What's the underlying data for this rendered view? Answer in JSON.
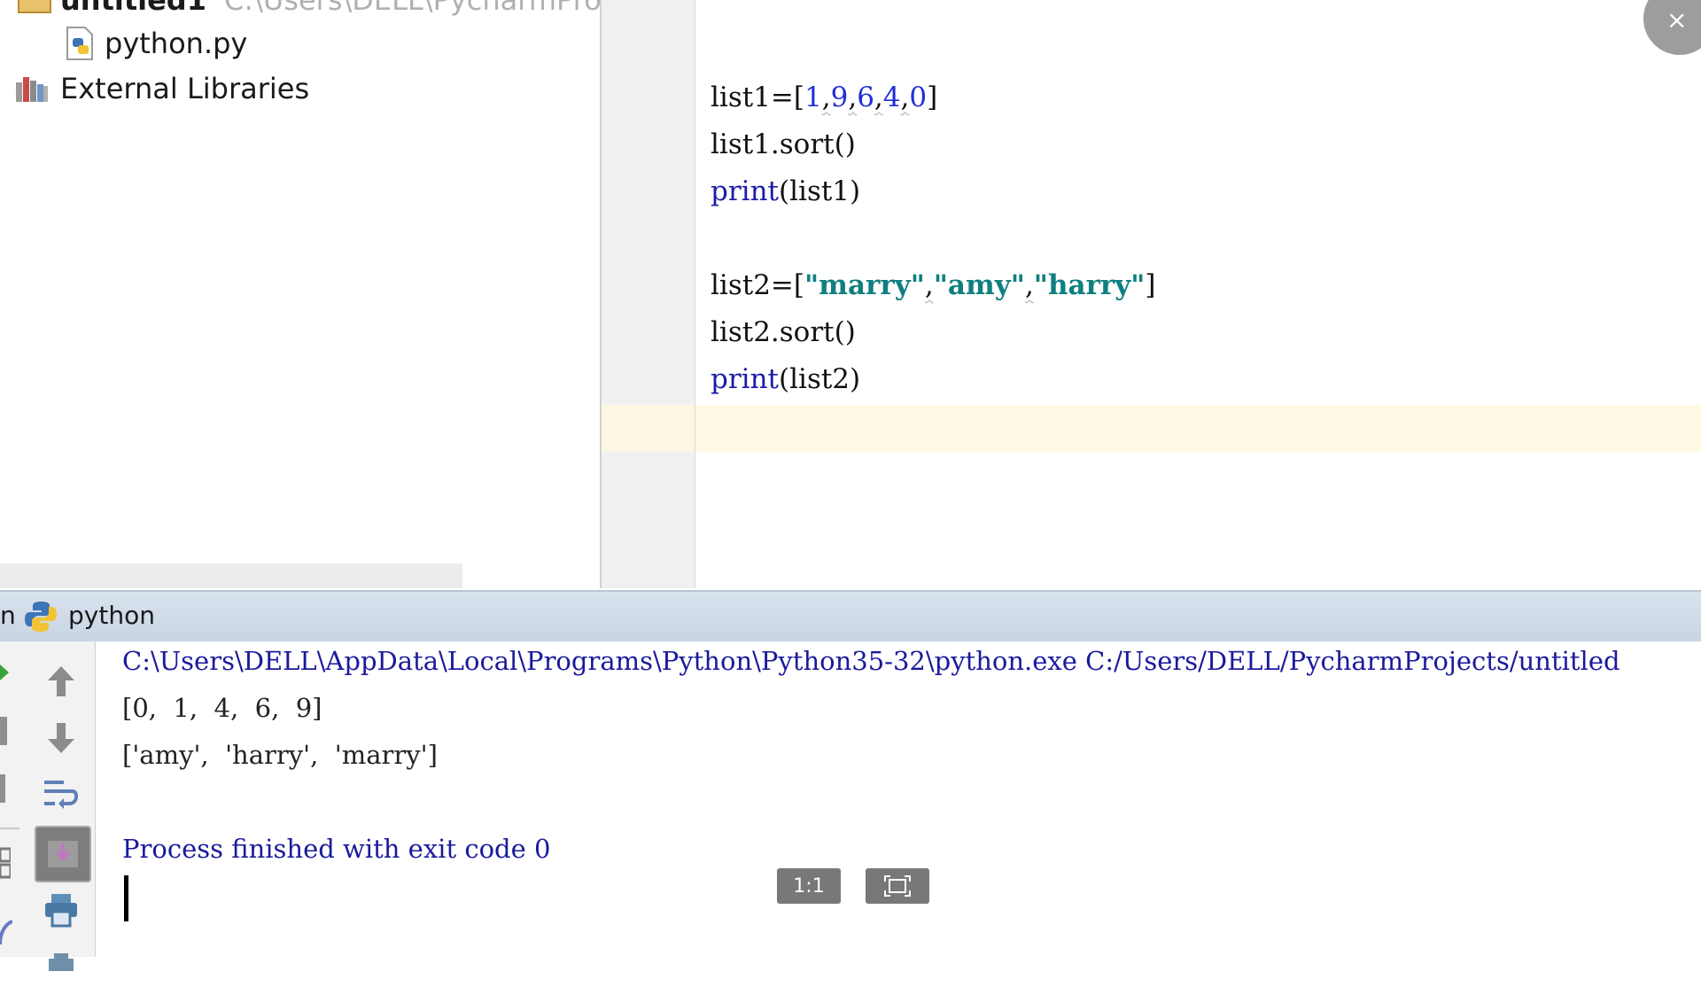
{
  "project_tree": {
    "root_name": "untitled1",
    "root_path": "C:\\Users\\DELL\\PycharmProject",
    "file_name": "python.py",
    "external_libraries": "External Libraries"
  },
  "editor": {
    "line1": {
      "prefix": "list1=[",
      "n1": "1",
      "n2": "9",
      "n3": "6",
      "n4": "4",
      "n5": "0",
      "suffix": "]",
      "sep": ","
    },
    "line2": "list1.sort()",
    "line3": {
      "kw": "print",
      "arg": "(list1)"
    },
    "line5": {
      "prefix": "list2=[",
      "s1": "\"marry\"",
      "s2": "\"amy\"",
      "s3": "\"harry\"",
      "sep": ",",
      "suffix": "]"
    },
    "line6": "list2.sort()",
    "line7": {
      "kw": "print",
      "arg": "(list2)"
    }
  },
  "run_panel": {
    "tab_prefix": "n",
    "tab_name": "python",
    "console": {
      "command": "C:\\Users\\DELL\\AppData\\Local\\Programs\\Python\\Python35-32\\python.exe C:/Users/DELL/PycharmProjects/untitled",
      "output1": "[0,  1,  4,  6,  9]",
      "output2": "['amy',  'harry',  'marry']",
      "exit_message": "Process finished with exit code 0"
    }
  },
  "viewer": {
    "close_label": "×",
    "actual_size_label": "1:1"
  }
}
